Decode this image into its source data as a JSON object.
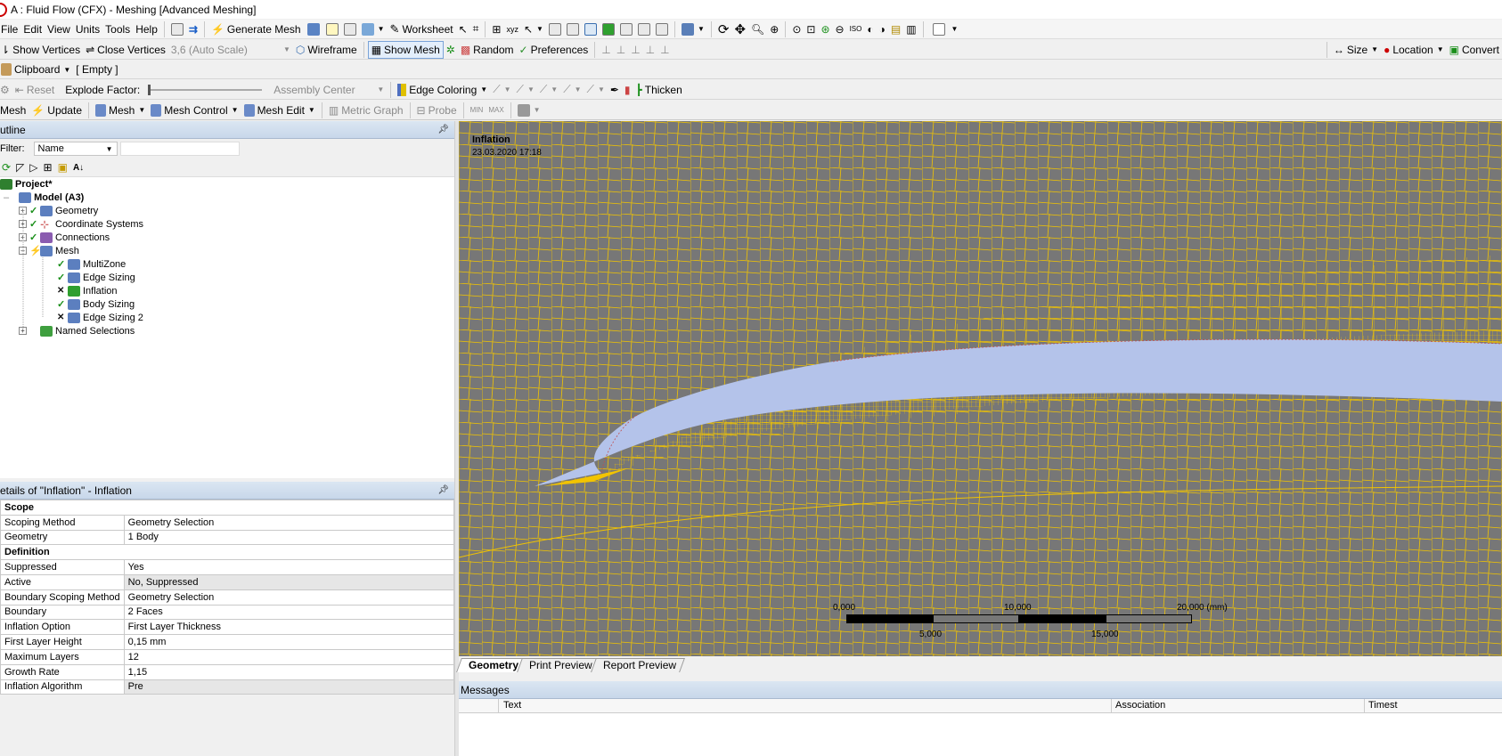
{
  "title": "A : Fluid Flow (CFX) - Meshing [Advanced Meshing]",
  "menu": [
    "File",
    "Edit",
    "View",
    "Units",
    "Tools",
    "Help"
  ],
  "toolbar1": {
    "generate_mesh": "Generate Mesh",
    "worksheet": "Worksheet"
  },
  "toolbar2": {
    "show_vertices": "Show Vertices",
    "close_vertices": "Close Vertices",
    "scale_value": "3,6 (Auto Scale)",
    "wireframe": "Wireframe",
    "show_mesh": "Show Mesh",
    "random": "Random",
    "preferences": "Preferences",
    "size": "Size",
    "location": "Location",
    "convert": "Convert"
  },
  "toolbar3": {
    "clipboard": "Clipboard",
    "empty": "[ Empty ]"
  },
  "toolbar4": {
    "reset": "Reset",
    "explode_factor": "Explode Factor:",
    "assembly_center": "Assembly Center",
    "edge_coloring": "Edge Coloring",
    "thicken": "Thicken"
  },
  "toolbar5": {
    "mesh": "Mesh",
    "update": "Update",
    "mesh_dd": "Mesh",
    "mesh_control": "Mesh Control",
    "mesh_edit": "Mesh Edit",
    "metric_graph": "Metric Graph",
    "probe": "Probe"
  },
  "outline": {
    "header": "utline",
    "filter_label": "Filter:",
    "filter_value": "Name",
    "tree": {
      "project": "Project*",
      "model": "Model (A3)",
      "geometry": "Geometry",
      "coordinate_systems": "Coordinate Systems",
      "connections": "Connections",
      "mesh": "Mesh",
      "multizone": "MultiZone",
      "edge_sizing": "Edge Sizing",
      "inflation": "Inflation",
      "body_sizing": "Body Sizing",
      "edge_sizing_2": "Edge Sizing 2",
      "named_selections": "Named Selections"
    }
  },
  "details": {
    "header": "etails of \"Inflation\" - Inflation",
    "rows": {
      "scope": "Scope",
      "scoping_method_k": "Scoping Method",
      "scoping_method_v": "Geometry Selection",
      "geometry_k": "Geometry",
      "geometry_v": "1 Body",
      "definition": "Definition",
      "suppressed_k": "Suppressed",
      "suppressed_v": "Yes",
      "active_k": "Active",
      "active_v": "No, Suppressed",
      "bsm_k": "Boundary Scoping Method",
      "bsm_v": "Geometry Selection",
      "boundary_k": "Boundary",
      "boundary_v": "2 Faces",
      "inflation_option_k": "Inflation Option",
      "inflation_option_v": "First Layer Thickness",
      "first_layer_height_k": "First Layer Height",
      "first_layer_height_v": "0,15 mm",
      "max_layers_k": "Maximum Layers",
      "max_layers_v": "12",
      "growth_rate_k": "Growth Rate",
      "growth_rate_v": "1,15",
      "inflation_algorithm_k": "Inflation Algorithm",
      "inflation_algorithm_v": "Pre"
    }
  },
  "viewport": {
    "label": "Inflation",
    "date": "23.03.2020 17:18",
    "scale_top": [
      "0,000",
      "10,000",
      "20,000 (mm)"
    ],
    "scale_bottom": [
      "5,000",
      "15,000"
    ]
  },
  "tabs": [
    "Geometry",
    "Print Preview",
    "Report Preview"
  ],
  "messages": {
    "header": "Messages",
    "col_text": "Text",
    "col_association": "Association",
    "col_timestamp": "Timest"
  },
  "colors": {
    "mesh_line": "#f2c400",
    "viewport_bg": "#777777",
    "body_fill": "#b4c3ea",
    "panel_header": "#cfdcec"
  }
}
